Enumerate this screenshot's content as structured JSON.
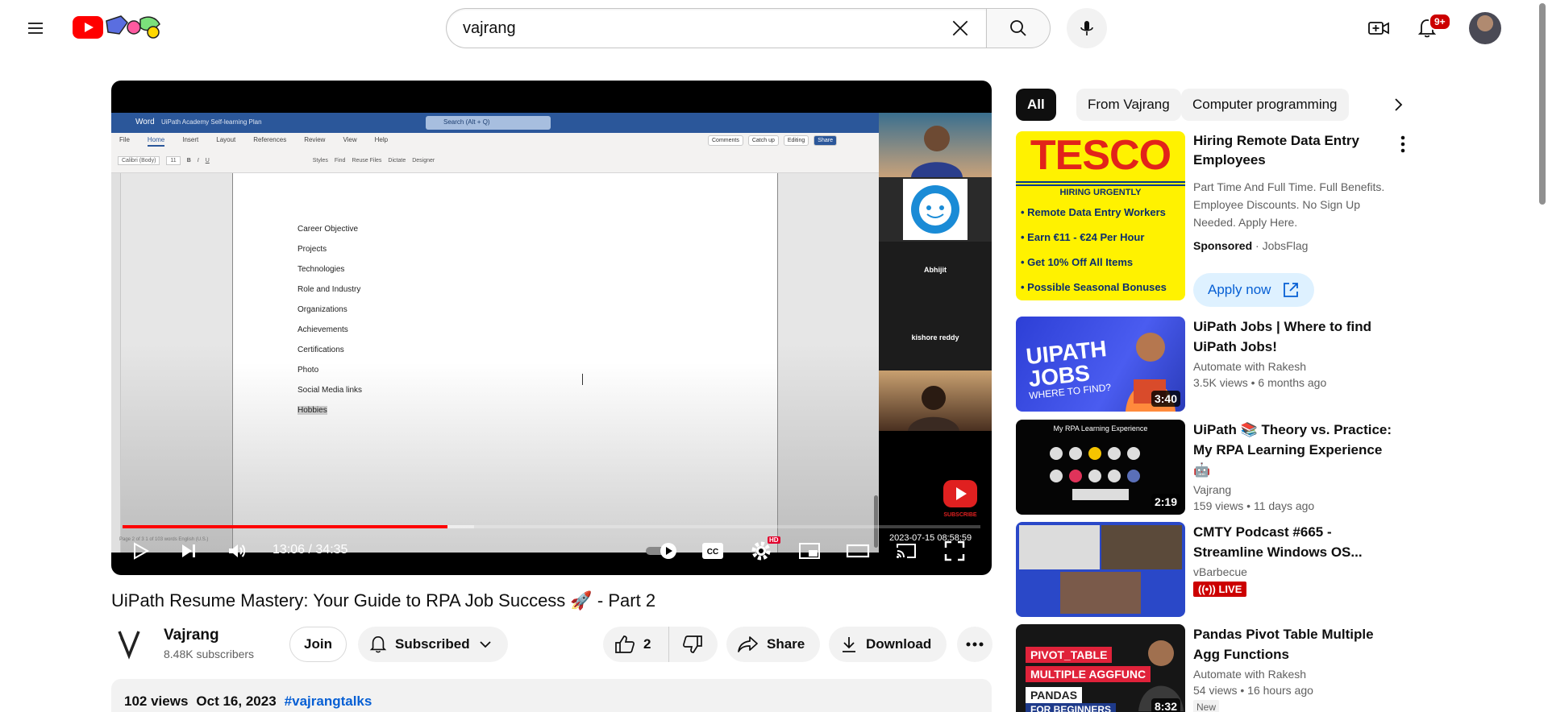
{
  "masthead": {
    "search_value": "vajrang",
    "notifications_badge": "9+"
  },
  "player": {
    "word": {
      "app": "Word",
      "doc_title": "UiPath Academy Self-learning Plan",
      "search_placeholder": "Search (Alt + Q)",
      "tabs": [
        "File",
        "Home",
        "Insert",
        "Layout",
        "References",
        "Review",
        "View",
        "Help"
      ],
      "right_buttons": [
        "Comments",
        "Catch up",
        "Editing",
        "Share"
      ],
      "tools": [
        "Calibri (Body)",
        "11",
        "B",
        "I",
        "U",
        "Styles",
        "Find",
        "Reuse Files",
        "Dictate",
        "Designer"
      ],
      "list_items": [
        "Career Objective",
        "Projects",
        "Technologies",
        "Role and Industry",
        "Organizations",
        "Achievements",
        "Certifications",
        "Photo",
        "Social Media links",
        "Hobbies"
      ],
      "status": "Page 2 of 3    1 of 103 words    English (U.S.)"
    },
    "participants": [
      "Abhijit",
      "kishore reddy"
    ],
    "subscribe_overlay": "SUBSCRIBE",
    "overlay_date": "2023-07-15  08:58:59",
    "time_current": "13:06",
    "time_separator": " / ",
    "time_total": "34:35",
    "progress_fraction": 0.379,
    "buffer_fraction": 0.41,
    "hd_badge": "HD"
  },
  "video": {
    "title": "UiPath Resume Mastery: Your Guide to RPA Job Success 🚀 - Part 2",
    "channel_name": "Vajrang",
    "subscribers": "8.48K subscribers",
    "join_label": "Join",
    "subscribed_label": "Subscribed",
    "likes": "2",
    "share_label": "Share",
    "download_label": "Download",
    "views": "102 views",
    "date": "Oct 16, 2023",
    "hashtag": "#vajrangtalks"
  },
  "chips": [
    "All",
    "From Vajrang",
    "Computer programming"
  ],
  "ad": {
    "thumb_logo": "TESCO",
    "thumb_hiring": "HIRING URGENTLY",
    "thumb_points": [
      "• Remote Data Entry Workers",
      "• Earn €11 - €24 Per Hour",
      "• Get 10% Off All Items",
      "• Possible Seasonal Bonuses"
    ],
    "title": "Hiring Remote Data Entry Employees",
    "description": "Part Time And Full Time. Full Benefits. Employee Discounts. No Sign Up Needed. Apply Here.",
    "sponsored": "Sponsored",
    "advertiser": "JobsFlag",
    "apply_label": "Apply now"
  },
  "recommendations": [
    {
      "title": "UiPath Jobs | Where to find UiPath Jobs!",
      "channel": "Automate with Rakesh",
      "views": "3.5K views",
      "age": "6 months ago",
      "duration": "3:40",
      "thumb_text": "UIPATH JOBS",
      "thumb_sub": "WHERE TO FIND?"
    },
    {
      "title": "UiPath 📚 Theory vs. Practice: My RPA Learning Experience 🤖",
      "channel": "Vajrang",
      "views": "159 views",
      "age": "11 days ago",
      "duration": "2:19",
      "thumb_text": "My RPA Learning Experience"
    },
    {
      "title": "CMTY Podcast #665 - Streamline Windows OS...",
      "channel": "vBarbecue",
      "live_label": "LIVE"
    },
    {
      "title": "Pandas Pivot Table Multiple Agg Functions",
      "channel": "Automate with Rakesh",
      "views": "54 views",
      "age": "16 hours ago",
      "duration": "8:32",
      "new_label": "New",
      "thumb_line1": "PIVOT_TABLE",
      "thumb_line2": "MULTIPLE AGGFUNC",
      "thumb_line3": "PANDAS",
      "thumb_line4": "FOR BEGINNERS"
    }
  ],
  "colors": {
    "accent": "#ff0000",
    "link": "#065fd4",
    "live": "#cc0000"
  }
}
